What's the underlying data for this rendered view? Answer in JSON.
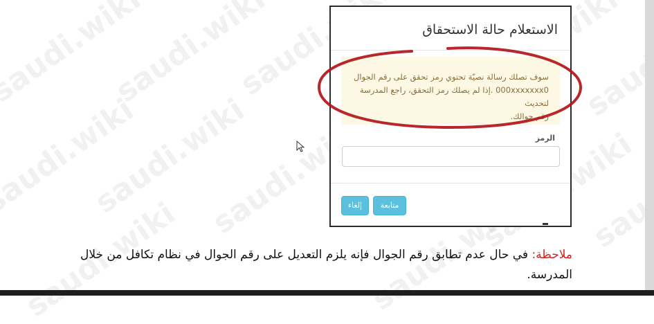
{
  "watermark": {
    "text": "saudi.wiki"
  },
  "dialog": {
    "title": "الاستعلام حالة الاستحقاق",
    "alert_line1": "سوف تصلك رسالة نصيّة تحتوي رمز تحقق على رقم الجوال",
    "alert_line2": "000xxxxxxx0 .إذا لم يصلك رمز التحقق، راجع المدرسة لتحديث",
    "alert_line3": "رقم جوالك.",
    "code_label": "الرمز",
    "code_value": "",
    "continue_label": "متابعة",
    "cancel_label": "إلغاء"
  },
  "note": {
    "label": "ملاحظة:",
    "text": " في حال عدم تطابق رقم الجوال فإنه يلزم التعديل على رقم الجوال في نظام تكافل من خلال المدرسة."
  },
  "colors": {
    "highlight_circle": "#b3151b",
    "alert_bg": "#fcf8e3",
    "alert_text": "#8a6d3b",
    "button_bg": "#5bc0de",
    "note_label": "#d21f1f"
  },
  "icons": {
    "cursor": "mouse-pointer-icon"
  }
}
